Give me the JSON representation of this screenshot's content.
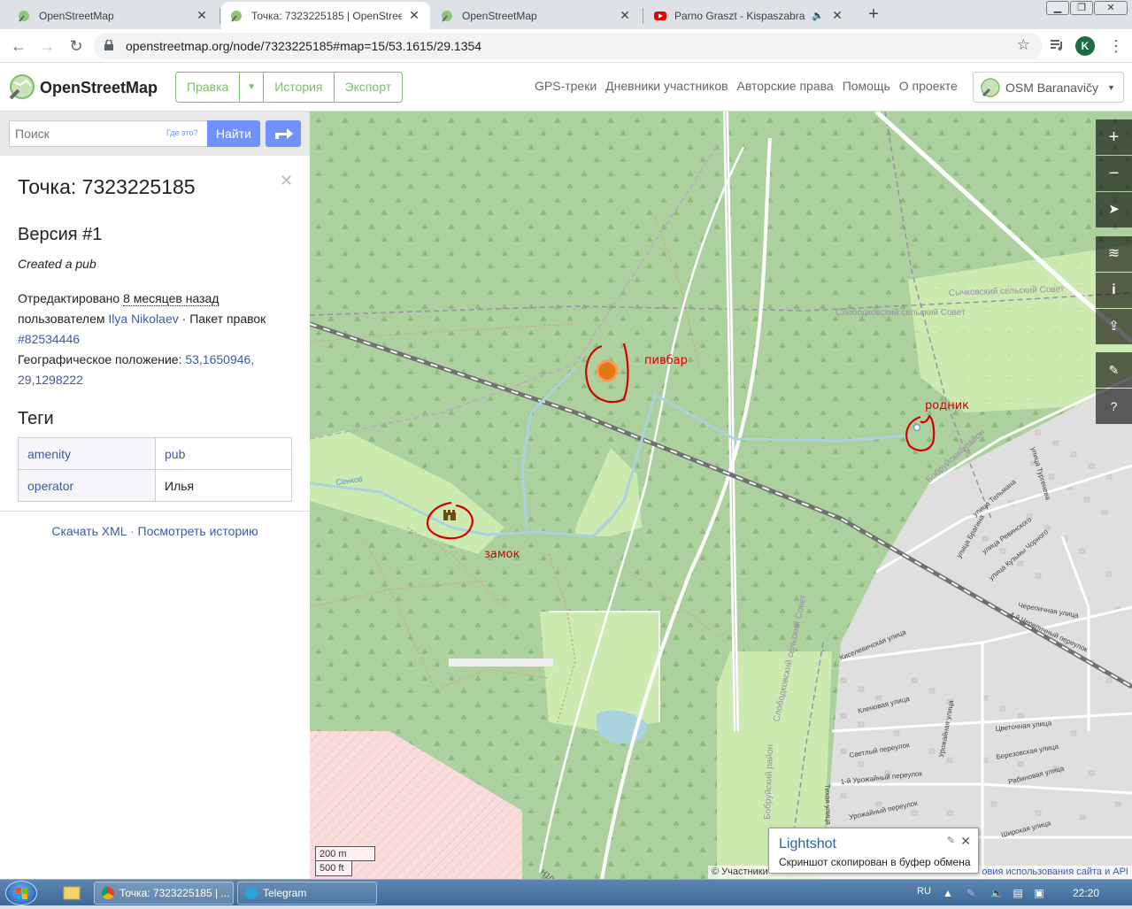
{
  "browser": {
    "tabs": [
      {
        "title": "OpenStreetMap",
        "active": false,
        "icon": "osm-favicon"
      },
      {
        "title": "Точка: 7323225185 | OpenStreetMap",
        "active": true,
        "icon": "osm-favicon"
      },
      {
        "title": "OpenStreetMap",
        "active": false,
        "icon": "osm-favicon"
      },
      {
        "title": "Parno Graszt - Kispaszabra ko",
        "active": false,
        "icon": "youtube-favicon"
      }
    ],
    "new_tab": "+",
    "url": "openstreetmap.org/node/7323225185#map=15/53.1615/29.1354",
    "profile_initial": "K"
  },
  "osm_header": {
    "logo_text": "OpenStreetMap",
    "edit": "Правка",
    "history": "История",
    "export": "Экспорт",
    "nav": [
      "GPS-треки",
      "Дневники участников",
      "Авторские права",
      "Помощь",
      "О проекте"
    ],
    "user": "OSM Baranavičy"
  },
  "sidebar": {
    "search_placeholder": "Поиск",
    "where_link": "Где это?",
    "search_button": "Найти",
    "node_title": "Точка: 7323225185",
    "version_title": "Версия #1",
    "version_comment": "Created a pub",
    "edited_label": "Отредактировано",
    "edited_when": "8 месяцев назад",
    "by_label": "пользователем",
    "user": "Ilya Nikolaev",
    "changeset_label": "· Пакет правок",
    "changeset": "#82534446",
    "location_label": "Географическое положение:",
    "location_lat": "53,1650946,",
    "location_lon": "29,1298222",
    "tags_title": "Теги",
    "tags": [
      {
        "key": "amenity",
        "value": "pub",
        "value_link": true
      },
      {
        "key": "operator",
        "value": "Илья",
        "value_link": false
      }
    ],
    "download_xml": "Скачать XML",
    "separator": "·",
    "view_history": "Посмотреть историю"
  },
  "map": {
    "annotations": {
      "pub": "пивбар",
      "spring": "родник",
      "castle": "замок"
    },
    "labels": {
      "council1": "Сычковский сельский Совет",
      "council2": "Слободковский сельский Совет",
      "council3": "Слободковский сельский Совет",
      "district1": "Бобруйский район",
      "district2": "Бобруйский район",
      "stream": "Сенков",
      "road": "H10076",
      "streets": [
        "улица Тельмана",
        "улица Ревинского",
        "улица Кузьмы Чорного",
        "улица Брагина",
        "Черепичная улица",
        "4-й Черепичный переулок",
        "Киселевичская улица",
        "Кленовая улица",
        "Цветочная улица",
        "Светлый переулок",
        "1-й Урожайный переулок",
        "Урожайный переулок",
        "Березовская улица",
        "Рабиновая улица",
        "Широкая улица",
        "Тихая улица",
        "Урожайная улица",
        "улица Тургенева"
      ]
    },
    "scale_m": "200 m",
    "scale_ft": "500 ft",
    "attribution_left": "© Участники",
    "attribution_right": "овия использования сайта и API",
    "controls": [
      "zoom-in",
      "zoom-out",
      "geolocate",
      "layers",
      "info",
      "share",
      "note",
      "query"
    ],
    "colors": {
      "forest": "#add19e",
      "meadow": "#cdebb0",
      "residential": "#e0dfdf",
      "water": "#aad3df",
      "annotation": "#d40000",
      "pub_marker": "#e4740e"
    }
  },
  "lightshot": {
    "title": "Lightshot",
    "message": "Скриншот скопирован в буфер обмена"
  },
  "taskbar": {
    "items": [
      {
        "label": "Точка: 7323225185 | ...",
        "icon": "chrome-icon"
      },
      {
        "label": "Telegram",
        "icon": "telegram-icon"
      }
    ],
    "lang": "RU",
    "clock": "22:20"
  }
}
